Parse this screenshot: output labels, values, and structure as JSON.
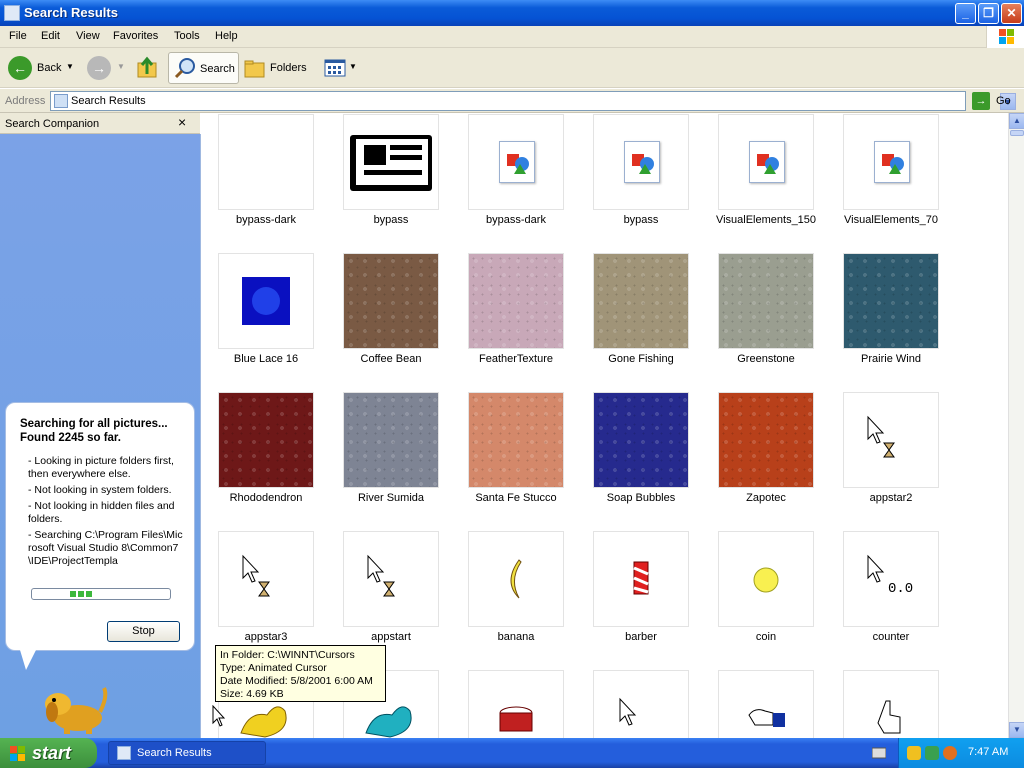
{
  "window": {
    "title": "Search Results"
  },
  "menu": [
    "File",
    "Edit",
    "View",
    "Favorites",
    "Tools",
    "Help"
  ],
  "toolbar": {
    "back": "Back",
    "search": "Search",
    "folders": "Folders"
  },
  "address": {
    "label": "Address",
    "value": "Search Results",
    "go": "Go"
  },
  "companion": {
    "title": "Search Companion",
    "close": "×",
    "status_line1": "Searching for all pictures...",
    "status_line2": "Found 2245 so far.",
    "notes": [
      "- Looking in picture folders first, then everywhere else.",
      "- Not looking in system folders.",
      "- Not looking in hidden files and folders.",
      "- Searching C:\\Program Files\\Microsoft Visual Studio 8\\Common7\\IDE\\ProjectTempla"
    ],
    "stop_button": "Stop"
  },
  "files": [
    {
      "name": "bypass-dark",
      "kind": "blank"
    },
    {
      "name": "bypass",
      "kind": "newspaper"
    },
    {
      "name": "bypass-dark",
      "kind": "image-file"
    },
    {
      "name": "bypass",
      "kind": "image-file"
    },
    {
      "name": "VisualElements_150",
      "kind": "image-file"
    },
    {
      "name": "VisualElements_70",
      "kind": "image-file"
    },
    {
      "name": "Blue Lace 16",
      "kind": "bluelace"
    },
    {
      "name": "Coffee Bean",
      "kind": "texture",
      "color": "#7a5a44"
    },
    {
      "name": "FeatherTexture",
      "kind": "texture",
      "color": "#c8a8b8"
    },
    {
      "name": "Gone Fishing",
      "kind": "texture",
      "color": "#a09478"
    },
    {
      "name": "Greenstone",
      "kind": "texture",
      "color": "#9a9e90"
    },
    {
      "name": "Prairie Wind",
      "kind": "texture",
      "color": "#2e5a6e"
    },
    {
      "name": "Rhododendron",
      "kind": "texture",
      "color": "#6e1818"
    },
    {
      "name": "River Sumida",
      "kind": "texture",
      "color": "#7e8494"
    },
    {
      "name": "Santa Fe Stucco",
      "kind": "texture",
      "color": "#d4886a"
    },
    {
      "name": "Soap Bubbles",
      "kind": "texture",
      "color": "#262a8e"
    },
    {
      "name": "Zapotec",
      "kind": "texture",
      "color": "#b8401a"
    },
    {
      "name": "appstar2",
      "kind": "cursor-hourglass"
    },
    {
      "name": "appstar3",
      "kind": "cursor-hourglass"
    },
    {
      "name": "appstart",
      "kind": "cursor-hourglass"
    },
    {
      "name": "banana",
      "kind": "banana"
    },
    {
      "name": "barber",
      "kind": "barber"
    },
    {
      "name": "coin",
      "kind": "coin"
    },
    {
      "name": "counter",
      "kind": "cursor-counter"
    },
    {
      "name": "",
      "kind": "dino-yellow"
    },
    {
      "name": "",
      "kind": "dino-teal"
    },
    {
      "name": "",
      "kind": "drum"
    },
    {
      "name": "",
      "kind": "arrow"
    },
    {
      "name": "",
      "kind": "hand-blue"
    },
    {
      "name": "",
      "kind": "hand-point"
    }
  ],
  "tooltip": {
    "folder": "In Folder: C:\\WINNT\\Cursors",
    "type": "Type: Animated Cursor",
    "modified": "Date Modified: 5/8/2001 6:00 AM",
    "size": "Size: 4.69 KB"
  },
  "taskbar": {
    "start": "start",
    "item": "Search Results",
    "clock": "7:47 AM"
  },
  "colors": {
    "titlebar": "#0a5bd8",
    "taskbar": "#245edc",
    "companion_panel": "#7ba2e7",
    "start_button": "#3c8f3c"
  }
}
